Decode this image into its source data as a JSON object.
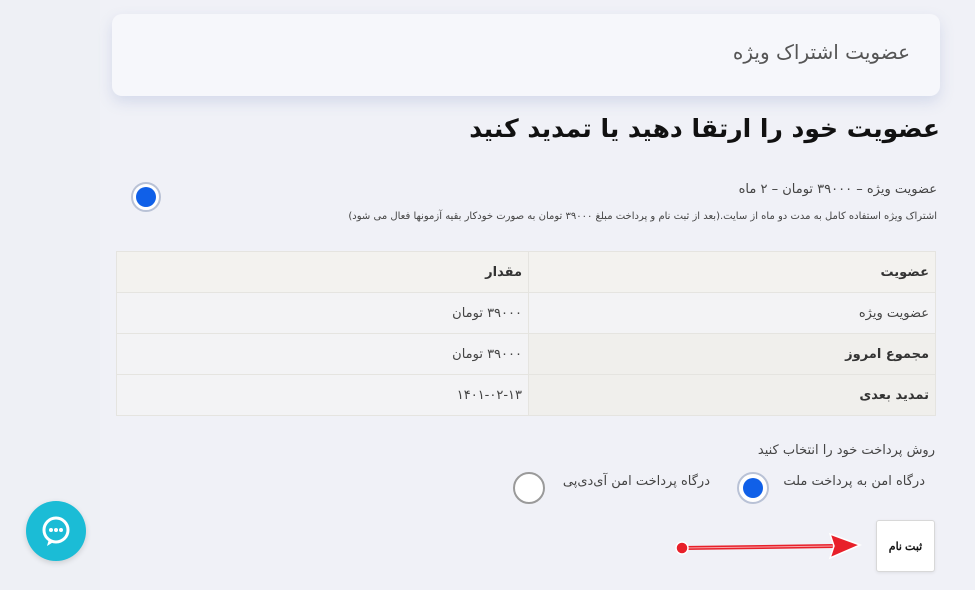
{
  "header": {
    "title": "عضویت اشتراک ویژه"
  },
  "main": {
    "heading": "عضویت خود را ارتقا دهید یا تمدید کنید",
    "plan": {
      "label": "عضویت ویژه – ۳۹۰۰۰ تومان – ۲ ماه",
      "description": "اشتراک ویژه استفاده کامل به مدت دو ماه از سایت.(بعد از ثبت نام و پرداخت مبلغ ۳۹۰۰۰ تومان به صورت خودکار بقیه آزمونها فعال می شود)",
      "selected": true
    },
    "table": {
      "headers": [
        "عضویت",
        "مقدار"
      ],
      "rows": [
        {
          "label": "عضویت ویژه",
          "value": "۳۹۰۰۰ تومان"
        },
        {
          "label": "مجموع امروز",
          "value": "۳۹۰۰۰ تومان"
        },
        {
          "label": "تمدید بعدی",
          "value": "۱۴۰۱-۰۲-۱۳"
        }
      ]
    },
    "payment": {
      "title": "روش پرداخت خود را انتخاب کنید",
      "options": [
        {
          "label": "درگاه امن به پرداخت ملت",
          "selected": true
        },
        {
          "label": "درگاه پرداخت امن آی‌دی‌پی",
          "selected": false
        }
      ]
    },
    "submit_label": "ثبت نام"
  },
  "colors": {
    "background": "#f0f1f7",
    "radio_selected": "#1060e8",
    "chat_button": "#1bbcd6",
    "annotation_arrow": "#e8202a"
  },
  "icons": {
    "chat": "chat-bubble-icon",
    "arrow": "red-arrow-annotation"
  }
}
